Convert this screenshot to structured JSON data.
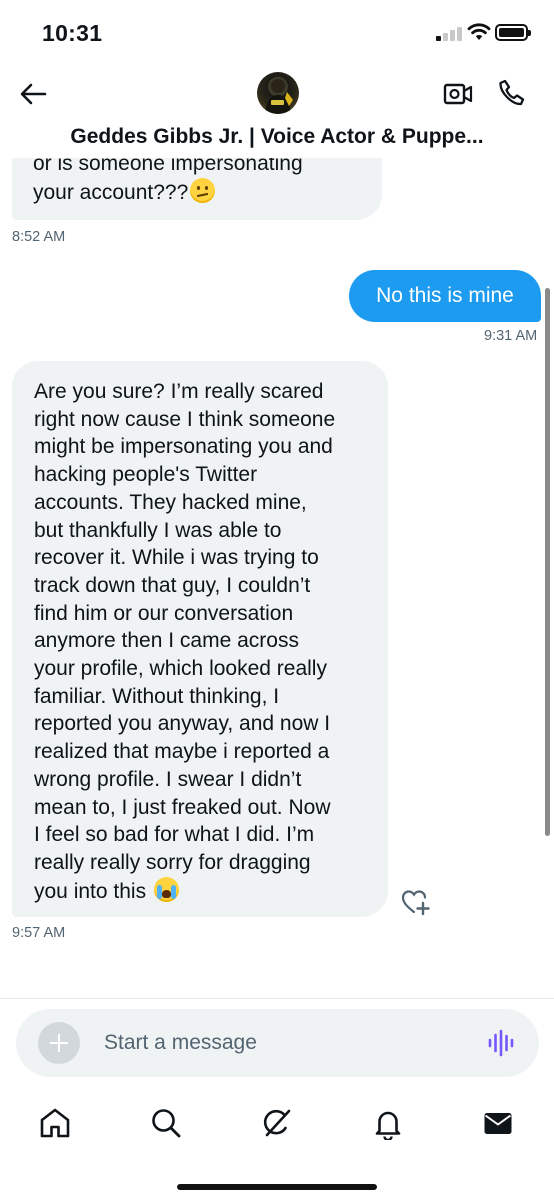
{
  "status_bar": {
    "time": "10:31"
  },
  "header": {
    "title": "Geddes Gibbs Jr. | Voice Actor & Puppe..."
  },
  "messages": [
    {
      "direction": "incoming",
      "lines": [
        "or is someone impersonating",
        "your account???"
      ],
      "emoji": "confused-face",
      "time": "8:52 AM"
    },
    {
      "direction": "outgoing",
      "text": "No this is mine",
      "time": "9:31 AM"
    },
    {
      "direction": "incoming",
      "lines": [
        "Are you sure? I’m really scared",
        "right now cause I think someone",
        "might be impersonating you and",
        "hacking people's Twitter",
        "accounts. They hacked mine,",
        "but thankfully I was able to",
        "recover it. While i was trying to",
        "track down that guy, I couldn’t",
        "find him or our conversation",
        "anymore then I came across",
        "your profile, which looked really",
        "familiar. Without thinking, I",
        "reported you anyway, and now I",
        "realized that maybe i reported a",
        "wrong profile. I swear I didn’t",
        "mean to, I just freaked out. Now",
        "I feel so bad for what I did. I’m",
        "really really sorry for dragging",
        "you into this"
      ],
      "emoji": "loudly-crying-face",
      "time": "9:57 AM"
    }
  ],
  "composer": {
    "placeholder": "Start a message"
  },
  "nav": [
    {
      "icon": "home-icon"
    },
    {
      "icon": "search-icon"
    },
    {
      "icon": "grok-icon"
    },
    {
      "icon": "notifications-icon"
    },
    {
      "icon": "messages-icon"
    }
  ],
  "colors": {
    "accent": "#1d9bf0",
    "bubble_incoming": "#eff3f4",
    "voice_icon": "#7856ff"
  }
}
